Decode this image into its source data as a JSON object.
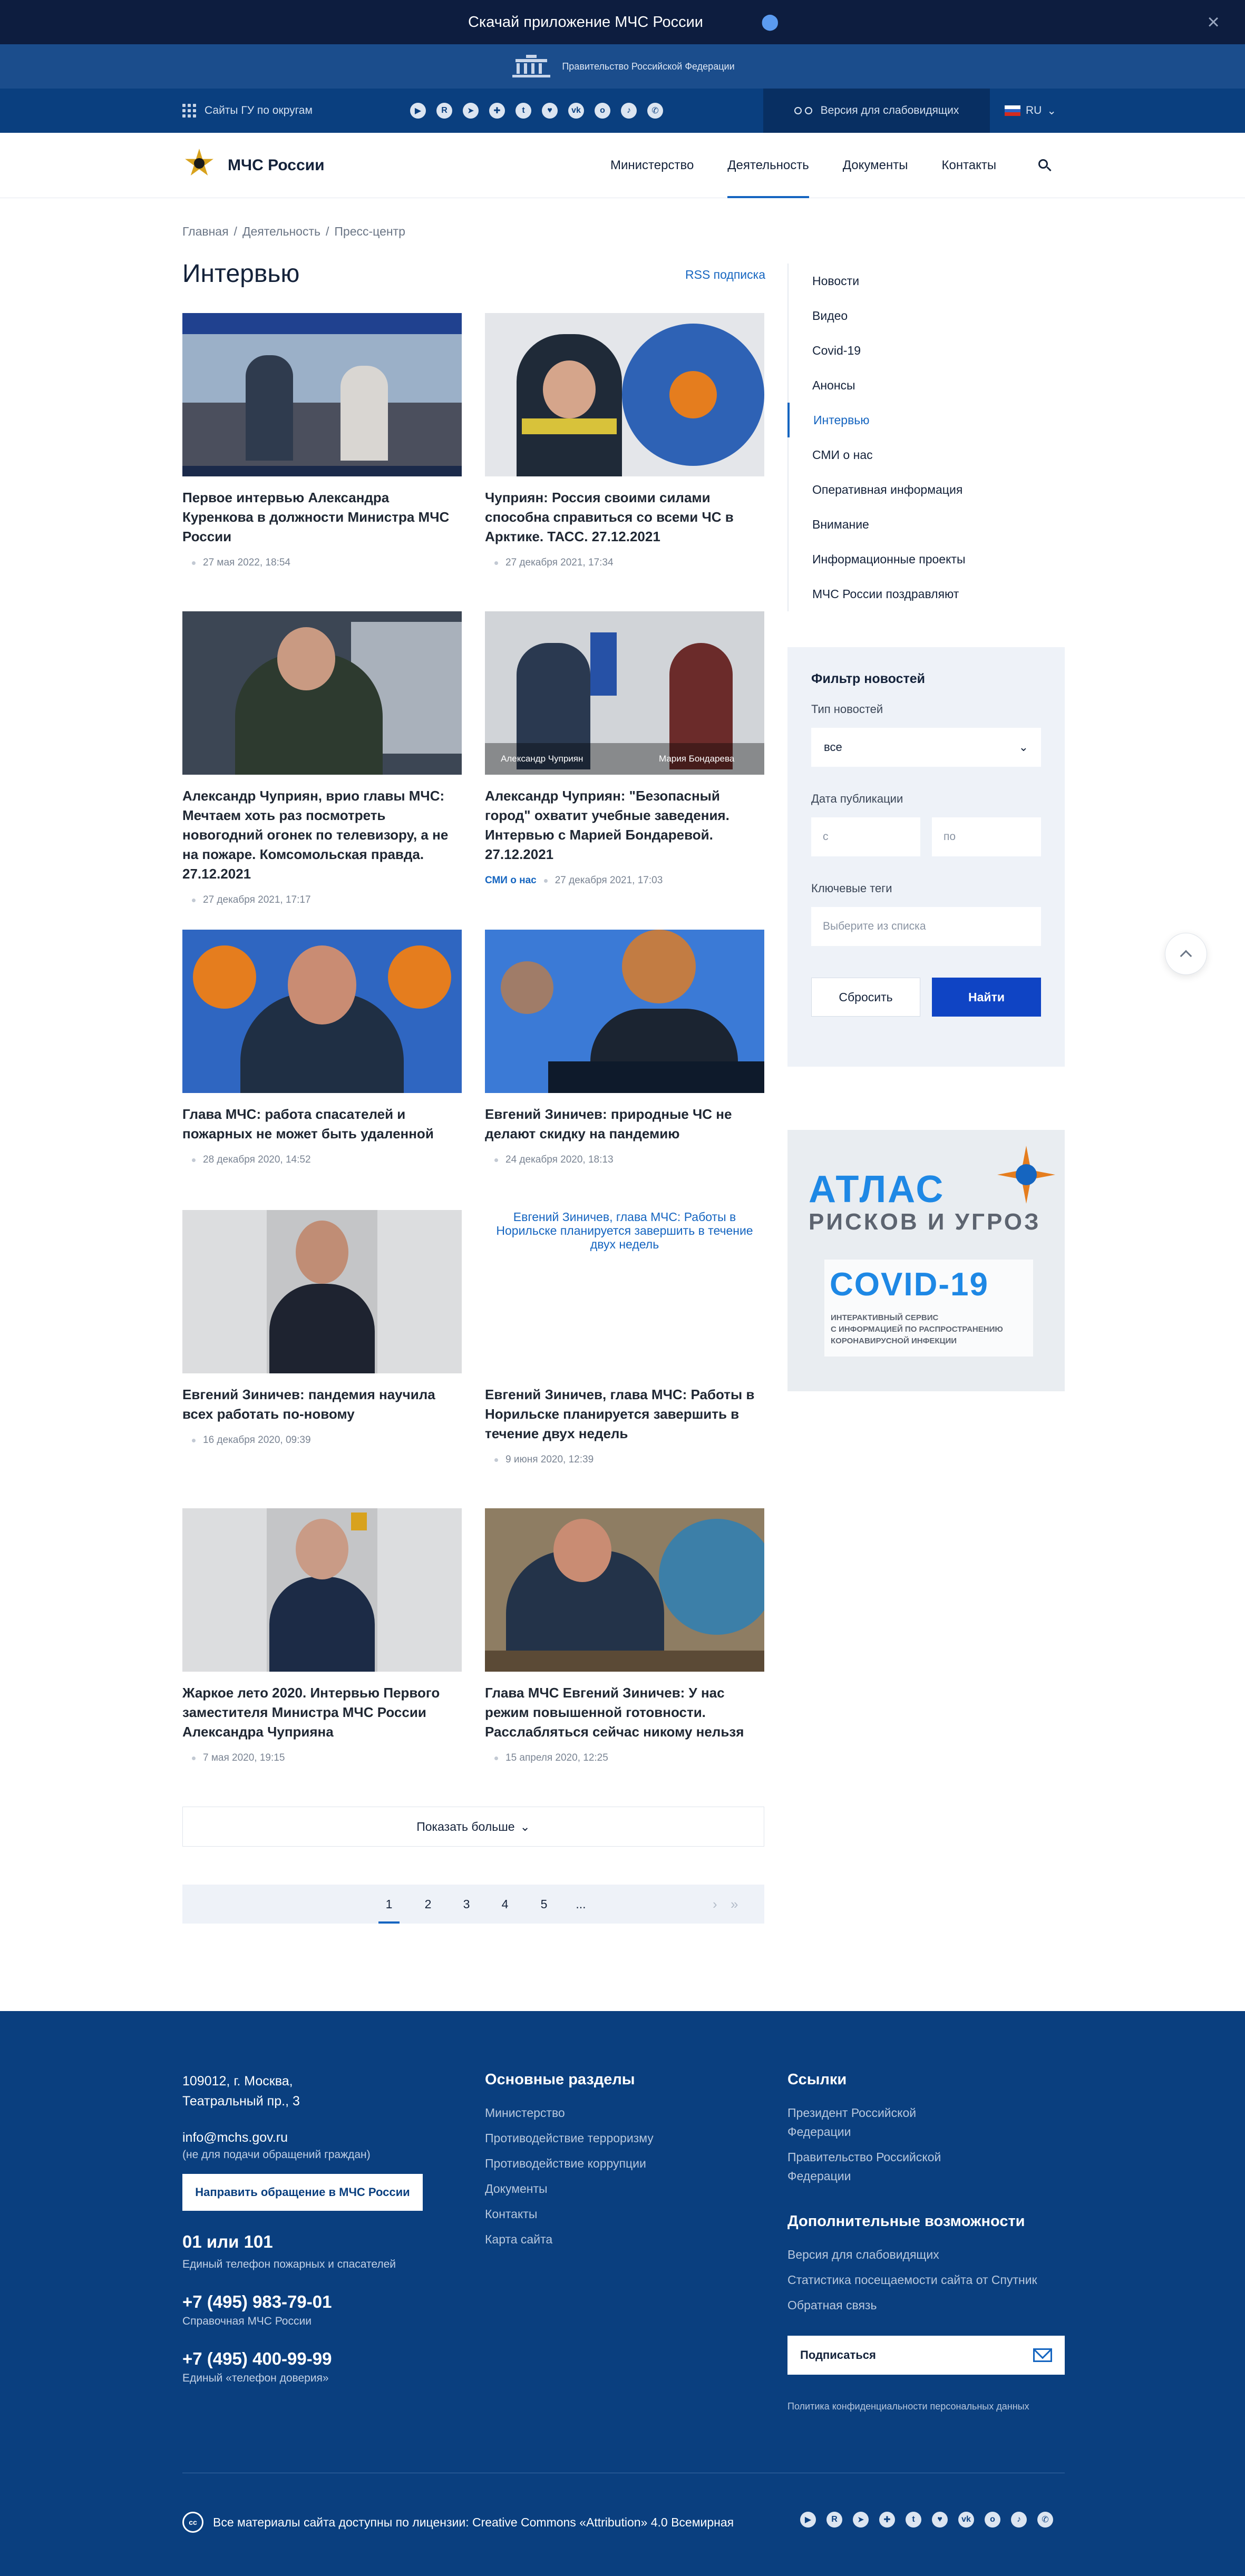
{
  "app_banner": {
    "text": "Скачай приложение МЧС России"
  },
  "gov_strip": {
    "text": "Правительство Российской Федерации"
  },
  "service_bar": {
    "tv_label": "Сайты ГУ по округам",
    "socials": [
      "youtube-icon",
      "rutube-icon",
      "telegram-icon",
      "odnoklassniki-circle-icon",
      "twitter-icon",
      "heart-icon",
      "vk-icon",
      "ok-icon",
      "tiktok-icon",
      "whatsapp-icon"
    ],
    "impaired": "Версия для слабовидящих",
    "lang": "RU"
  },
  "header": {
    "brand": "МЧС России",
    "nav": [
      "Министерство",
      "Деятельность",
      "Документы",
      "Контакты"
    ],
    "active_nav": "Деятельность"
  },
  "breadcrumb": [
    "Главная",
    "Деятельность",
    "Пресс-центр"
  ],
  "page": {
    "title": "Интервью",
    "rss": "RSS подписка"
  },
  "articles": [
    {
      "title": "Первое интервью Александра Куренкова в должности Министра МЧС России",
      "date": "27 мая 2022, 18:54"
    },
    {
      "title": "Чуприян: Россия своими силами способна справиться со всеми ЧС в Арктике. ТАСС. 27.12.2021",
      "date": "27 декабря 2021, 17:34"
    },
    {
      "title": "Александр Чуприян, врио главы МЧС: Мечтаем хоть раз посмотреть новогодний огонек по телевизору, а не на пожаре. Комсомольская правда. 27.12.2021",
      "date": "27 декабря 2021, 17:17"
    },
    {
      "title": "Александр Чуприян: \"Безопасный город\" охватит учебные заведения. Интервью с Марией Бондаревой. 27.12.2021",
      "date": "27 декабря 2021, 17:03",
      "tag": "СМИ о нас",
      "caption_left": "Александр Чуприян",
      "caption_right": "Мария Бондарева"
    },
    {
      "title": "Глава МЧС: работа спасателей и пожарных не может быть удаленной",
      "date": "28 декабря 2020, 14:52"
    },
    {
      "title": "Евгений Зиничев: природные ЧС не делают скидку на пандемию",
      "date": "24 декабря 2020, 18:13"
    },
    {
      "title": "Евгений Зиничев: пандемия научила всех работать по-новому",
      "date": "16 декабря 2020, 09:39"
    },
    {
      "title": "Евгений Зиничев, глава МЧС: Работы в Норильске планируется завершить в течение двух недель",
      "date": "9 июня 2020, 12:39",
      "image_alt": "Евгений Зиничев, глава МЧС: Работы в Норильске планируется завершить в течение двух недель"
    },
    {
      "title": "Жаркое лето 2020. Интервью Первого заместителя Министра МЧС России Александра Чуприяна",
      "date": "7 мая 2020, 19:15"
    },
    {
      "title": "Глава МЧС Евгений Зиничев: У нас режим повышенной готовности. Расслабляться сейчас никому нельзя",
      "date": "15 апреля 2020, 12:25"
    }
  ],
  "sidebar": {
    "items": [
      "Новости",
      "Видео",
      "Covid-19",
      "Анонсы",
      "Интервью",
      "СМИ о нас",
      "Оперативная информация",
      "Внимание",
      "Информационные проекты",
      "МЧС России поздравляют"
    ],
    "active": "Интервью"
  },
  "filter": {
    "title": "Фильтр новостей",
    "type_label": "Тип новостей",
    "type_value": "все",
    "date_label": "Дата публикации",
    "date_from": "с",
    "date_to": "по",
    "tags_label": "Ключевые теги",
    "tags_placeholder": "Выберите из списка",
    "reset": "Сбросить",
    "find": "Найти"
  },
  "atlas": {
    "title1": "АТЛАС",
    "title2": "РИСКОВ И УГРОЗ",
    "covid": "COVID-19",
    "sub1": "ИНТЕРАКТИВНЫЙ СЕРВИС",
    "sub2": "С ИНФОРМАЦИЕЙ ПО РАСПРОСТРАНЕНИЮ",
    "sub3": "КОРОНАВИРУСНОЙ ИНФЕКЦИИ"
  },
  "show_more": "Показать больше",
  "pagination": {
    "pages": [
      "1",
      "2",
      "3",
      "4",
      "5",
      "..."
    ],
    "current": "1"
  },
  "footer": {
    "address1": "109012, г. Москва,",
    "address2": "Театральный пр., 3",
    "email": "info@mchs.gov.ru",
    "email_note": "(не для подачи обращений граждан)",
    "appeal_button": "Направить обращение в МЧС России",
    "phone1": "01 или 101",
    "phone1_note": "Единый телефон пожарных и спасателей",
    "phone2": "+7 (495) 983-79-01",
    "phone2_note": "Справочная МЧС России",
    "phone3": "+7 (495) 400-99-99",
    "phone3_note": "Единый «телефон доверия»",
    "sections_title": "Основные разделы",
    "sections": [
      "Министерство",
      "Противодействие терроризму",
      "Противодействие коррупции",
      "Документы",
      "Контакты",
      "Карта сайта"
    ],
    "links_title": "Ссылки",
    "links": [
      "Президент Российской Федерации",
      "Правительство Российской Федерации"
    ],
    "extra_title": "Дополнительные возможности",
    "extra": [
      "Версия для слабовидящих",
      "Статистика посещаемости сайта от Спутник",
      "Обратная связь"
    ],
    "subscribe": "Подписаться",
    "policy": "Политика конфиденциальности персональных данных",
    "license": "Все материалы сайта доступны по лицензии: Creative Commons «Attribution» 4.0 Всемирная"
  }
}
